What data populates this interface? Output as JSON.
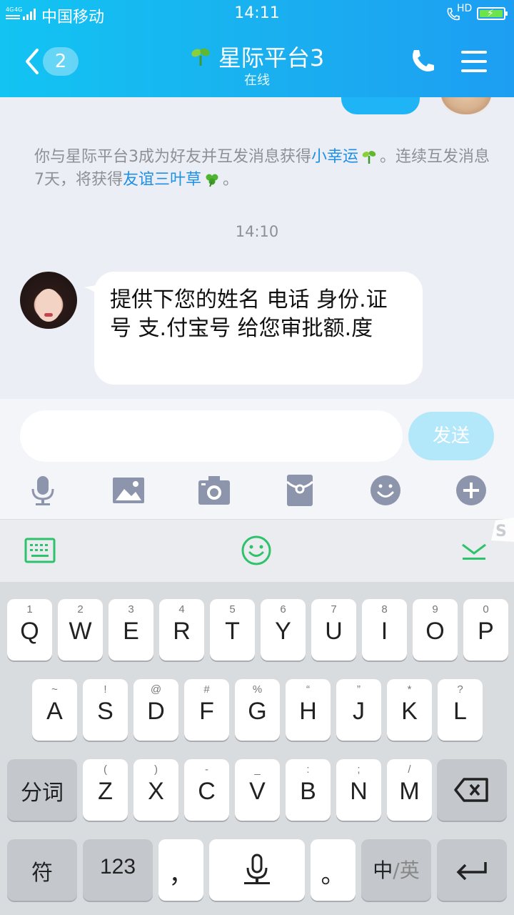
{
  "status_bar": {
    "carrier": "中国移动",
    "time": "14:11",
    "hd": "HD"
  },
  "header": {
    "unread_count": "2",
    "title": "星际平台3",
    "subtitle": "在线"
  },
  "chat": {
    "system_message": {
      "part1": "你与星际平台3成为好友并互发消息获得",
      "link1": "小幸运",
      "part2": "。连续互发消息7天，将获得",
      "link2": "友谊三叶草",
      "part3": "。"
    },
    "timestamp": "14:10",
    "message_text": "提供下您的姓名 电话 身份.证号 支.付宝号 给您审批额.度"
  },
  "input": {
    "value": "",
    "placeholder": "",
    "send_label": "发送"
  },
  "keyboard": {
    "row1": [
      {
        "key": "Q",
        "sub": "1"
      },
      {
        "key": "W",
        "sub": "2"
      },
      {
        "key": "E",
        "sub": "3"
      },
      {
        "key": "R",
        "sub": "4"
      },
      {
        "key": "T",
        "sub": "5"
      },
      {
        "key": "Y",
        "sub": "6"
      },
      {
        "key": "U",
        "sub": "7"
      },
      {
        "key": "I",
        "sub": "8"
      },
      {
        "key": "O",
        "sub": "9"
      },
      {
        "key": "P",
        "sub": "0"
      }
    ],
    "row2": [
      {
        "key": "A",
        "sub": "~"
      },
      {
        "key": "S",
        "sub": "!"
      },
      {
        "key": "D",
        "sub": "@"
      },
      {
        "key": "F",
        "sub": "#"
      },
      {
        "key": "G",
        "sub": "%"
      },
      {
        "key": "H",
        "sub": "“"
      },
      {
        "key": "J",
        "sub": "”"
      },
      {
        "key": "K",
        "sub": "*"
      },
      {
        "key": "L",
        "sub": "?"
      }
    ],
    "row3": [
      {
        "key": "Z",
        "sub": "("
      },
      {
        "key": "X",
        "sub": ")"
      },
      {
        "key": "C",
        "sub": "-"
      },
      {
        "key": "V",
        "sub": "_"
      },
      {
        "key": "B",
        "sub": ":"
      },
      {
        "key": "N",
        "sub": ";"
      },
      {
        "key": "M",
        "sub": "/"
      }
    ],
    "fenci_label": "分词",
    "symbols_label": "符",
    "numbers_label": "123",
    "comma_label": "，",
    "period_label": "。",
    "lang_label_cn": "中",
    "lang_label_en": "/英"
  },
  "colors": {
    "header_start": "#12c4f2",
    "header_end": "#1d9ef2",
    "link": "#1e90e6",
    "keyboard_green": "#2fc26c"
  }
}
